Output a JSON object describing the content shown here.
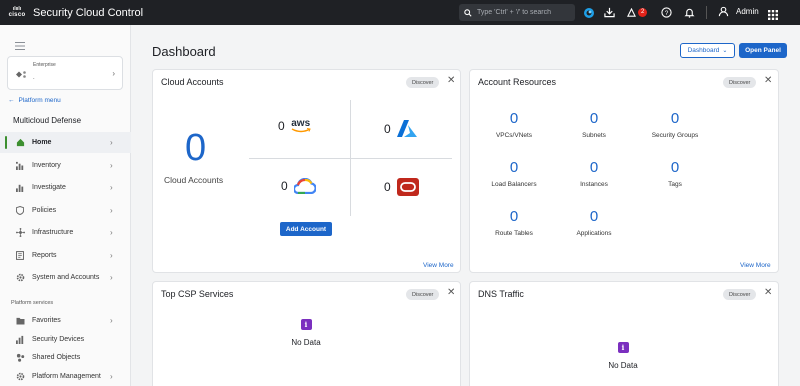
{
  "topbar": {
    "brand": "cisco",
    "title": "Security Cloud Control",
    "search_placeholder": "Type 'Ctrl' + '/' to search",
    "notification_count": "2",
    "user": "Admin"
  },
  "sidebar": {
    "tenant_label": "Enterprise",
    "tenant_value": ".",
    "platform_menu": "Platform menu",
    "section_title": "Multicloud Defense",
    "items": [
      {
        "label": "Home"
      },
      {
        "label": "Inventory"
      },
      {
        "label": "Investigate"
      },
      {
        "label": "Policies"
      },
      {
        "label": "Infrastructure"
      },
      {
        "label": "Reports"
      },
      {
        "label": "System and Accounts"
      }
    ],
    "platform_services_title": "Platform services",
    "services": [
      {
        "label": "Favorites"
      },
      {
        "label": "Security Devices"
      },
      {
        "label": "Shared Objects"
      },
      {
        "label": "Platform Management"
      }
    ]
  },
  "main": {
    "title": "Dashboard",
    "dashboard_button": "Dashboard",
    "open_panel_button": "Open Panel"
  },
  "cards": {
    "cloud_accounts": {
      "title": "Cloud Accounts",
      "discover": "Discover",
      "total": "0",
      "total_label": "Cloud Accounts",
      "aws_count": "0",
      "aws_label": "aws",
      "azure_count": "0",
      "gcp_count": "0",
      "oci_count": "0",
      "add_account": "Add Account",
      "view_more": "View More"
    },
    "account_resources": {
      "title": "Account Resources",
      "discover": "Discover",
      "view_more": "View More",
      "items": [
        {
          "value": "0",
          "label": "VPCs/VNets"
        },
        {
          "value": "0",
          "label": "Subnets"
        },
        {
          "value": "0",
          "label": "Security Groups"
        },
        {
          "value": "0",
          "label": "Load Balancers"
        },
        {
          "value": "0",
          "label": "Instances"
        },
        {
          "value": "0",
          "label": "Tags"
        },
        {
          "value": "0",
          "label": "Route Tables"
        },
        {
          "value": "0",
          "label": "Applications"
        }
      ]
    },
    "top_csp": {
      "title": "Top CSP Services",
      "discover": "Discover",
      "no_data": "No Data"
    },
    "dns_traffic": {
      "title": "DNS Traffic",
      "discover": "Discover",
      "no_data": "No Data"
    }
  }
}
